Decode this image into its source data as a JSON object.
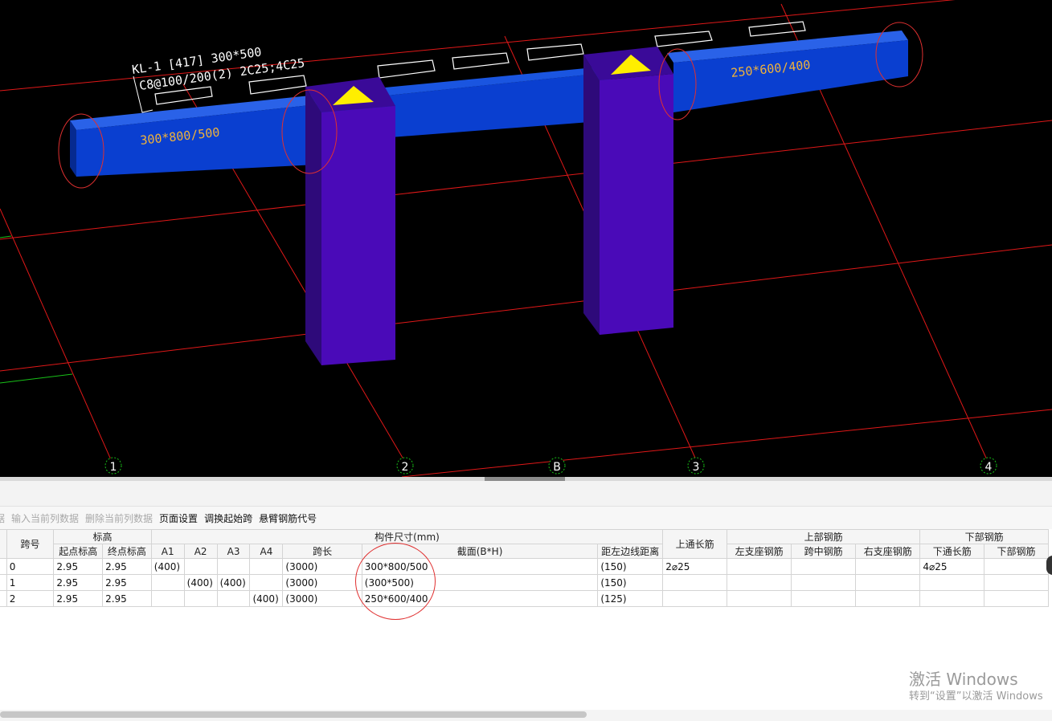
{
  "viewport": {
    "axes": [
      "1",
      "2",
      "B",
      "3",
      "4"
    ],
    "beam_note_line1": "KL-1 [417] 300*500",
    "beam_note_line2": "C8@100/200(2) 2C25;4C25",
    "span_labels": [
      "300*800/500",
      "250*600/400"
    ],
    "colors": {
      "beam": "#0a3fd0",
      "column": "#4a0ab8",
      "grid_line": "#e01818",
      "marker": "#ffee00",
      "label": "#f0b23a"
    }
  },
  "toolbar": {
    "items": [
      {
        "label": "据",
        "enabled": false
      },
      {
        "label": "输入当前列数据",
        "enabled": false
      },
      {
        "label": "删除当前列数据",
        "enabled": false
      },
      {
        "label": "页面设置",
        "enabled": true
      },
      {
        "label": "调换起始跨",
        "enabled": true
      },
      {
        "label": "悬臂钢筋代号",
        "enabled": true
      }
    ]
  },
  "table": {
    "groups": {
      "span_no": "跨号",
      "elevation": "标高",
      "size": "构件尺寸(mm)",
      "top_long": "上通长筋",
      "top_rebar": "上部钢筋",
      "bottom_rebar": "下部钢筋"
    },
    "columns": {
      "start_elev": "起点标高",
      "end_elev": "终点标高",
      "a1": "A1",
      "a2": "A2",
      "a3": "A3",
      "a4": "A4",
      "span_len": "跨长",
      "section": "截面(B*H)",
      "offset": "距左边线距离",
      "left_seat": "左支座钢筋",
      "mid_span": "跨中钢筋",
      "right_seat": "右支座钢筋",
      "bottom_long": "下通长筋",
      "bottom_other": "下部钢筋"
    },
    "rows": [
      {
        "span": "0",
        "start": "2.95",
        "end": "2.95",
        "a1": "(400)",
        "a2": "",
        "a3": "",
        "a4": "",
        "len": "(3000)",
        "section": "300*800/500",
        "offset": "(150)",
        "top_long": "2⌀25",
        "left": "",
        "mid": "",
        "right": "",
        "bottom_long": "4⌀25",
        "bottom_other": ""
      },
      {
        "span": "1",
        "start": "2.95",
        "end": "2.95",
        "a1": "",
        "a2": "(400)",
        "a3": "(400)",
        "a4": "",
        "len": "(3000)",
        "section": "(300*500)",
        "offset": "(150)",
        "top_long": "",
        "left": "",
        "mid": "",
        "right": "",
        "bottom_long": "",
        "bottom_other": ""
      },
      {
        "span": "2",
        "start": "2.95",
        "end": "2.95",
        "a1": "",
        "a2": "",
        "a3": "",
        "a4": "(400)",
        "len": "(3000)",
        "section": "250*600/400",
        "offset": "(125)",
        "top_long": "",
        "left": "",
        "mid": "",
        "right": "",
        "bottom_long": "",
        "bottom_other": ""
      }
    ]
  },
  "watermark": {
    "line1": "激活 Windows",
    "line2": "转到“设置”以激活 Windows"
  }
}
